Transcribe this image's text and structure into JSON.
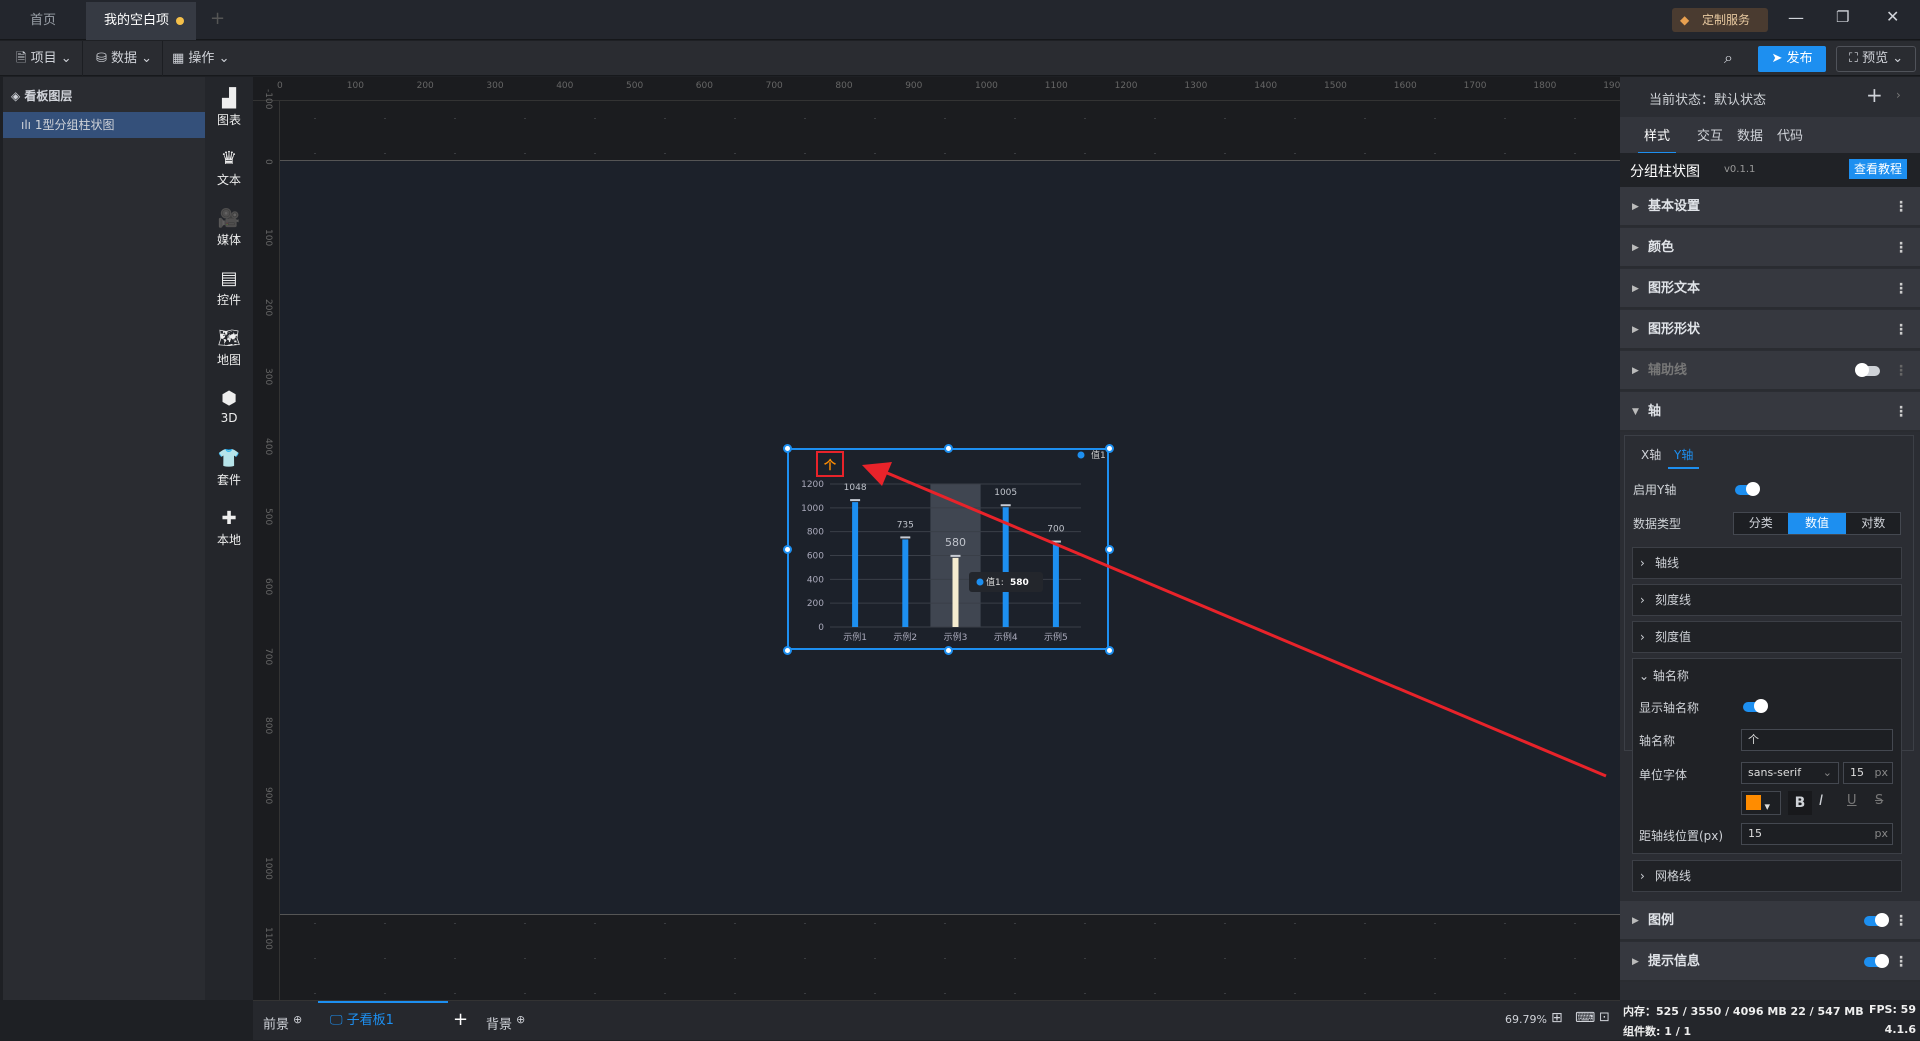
{
  "titlebar": {
    "tabs": [
      "首页",
      "我的空白项目"
    ],
    "custom_service": "定制服务",
    "unsaved_dot_color": "#f5c04a"
  },
  "toolbar": {
    "menus": [
      "项目",
      "数据",
      "操作"
    ],
    "publish": "发布",
    "preview": "预览"
  },
  "layers": {
    "title": "看板图层",
    "items": [
      "1型分组柱状图"
    ]
  },
  "components": [
    "图表",
    "文本",
    "媒体",
    "控件",
    "地图",
    "3D",
    "套件",
    "本地"
  ],
  "ruler": {
    "h_ticks": [
      "0",
      "100",
      "200",
      "300",
      "400",
      "500",
      "600",
      "700",
      "800",
      "900",
      "1000",
      "1100",
      "1200",
      "1300",
      "1400",
      "1500",
      "1600",
      "1700",
      "1800",
      "1900"
    ],
    "v_ticks": [
      "-100",
      "0",
      "100",
      "200",
      "300",
      "400",
      "500",
      "600",
      "700",
      "800",
      "900",
      "1000",
      "1100"
    ]
  },
  "chart_data": {
    "type": "bar",
    "categories": [
      "示例1",
      "示例2",
      "示例3",
      "示例4",
      "示例5"
    ],
    "series": [
      {
        "name": "值1",
        "values": [
          1048,
          735,
          580,
          1005,
          700
        ],
        "color": "#1d8ff0"
      }
    ],
    "ylim": [
      0,
      1200
    ],
    "yticks": [
      "0",
      "200",
      "400",
      "600",
      "800",
      "1000",
      "1200"
    ],
    "ylabel": "个",
    "ylabel_color": "#ff8c00",
    "highlight_index": 2,
    "highlight_color": "#f5ecd0",
    "legend": "top-right",
    "grid": true,
    "tooltip": {
      "label": "值1:",
      "value": "580"
    }
  },
  "bottom": {
    "foreground": "前景",
    "board": "子看板1",
    "background": "背景",
    "zoom": "69.79%"
  },
  "panel": {
    "state_label": "当前状态：",
    "state_value": "默认状态",
    "tabs": [
      "样式",
      "交互",
      "数据",
      "代码"
    ],
    "component_name": "分组柱状图",
    "version": "v0.1.1",
    "tutorial": "查看教程",
    "sections": [
      "基本设置",
      "颜色",
      "图形文本",
      "图形形状",
      "辅助线",
      "轴"
    ],
    "axis_tabs": [
      "X轴",
      "Y轴"
    ],
    "enable_y": "启用Y轴",
    "data_type_label": "数据类型",
    "data_types": [
      "分类",
      "数值",
      "对数"
    ],
    "data_type_selected": "数值",
    "subsections": [
      "轴线",
      "刻度线",
      "刻度值"
    ],
    "axis_name": {
      "title": "轴名称",
      "show_label": "显示轴名称",
      "name_label": "轴名称",
      "name_value": "个",
      "font_label": "单位字体",
      "font_value": "sans-serif",
      "font_size": "15",
      "unit": "px",
      "color": "#ff8c00",
      "offset_label": "距轴线位置(px)",
      "offset_value": "15"
    },
    "grid_section": "网格线",
    "legend_section": "图例",
    "tooltip_section": "提示信息"
  },
  "status": {
    "memory": "内存：525 / 3550 / 4096 MB  22 / 547 MB",
    "fps": "FPS:  59",
    "count": "组件数: 1 / 1",
    "version": "4.1.6"
  }
}
